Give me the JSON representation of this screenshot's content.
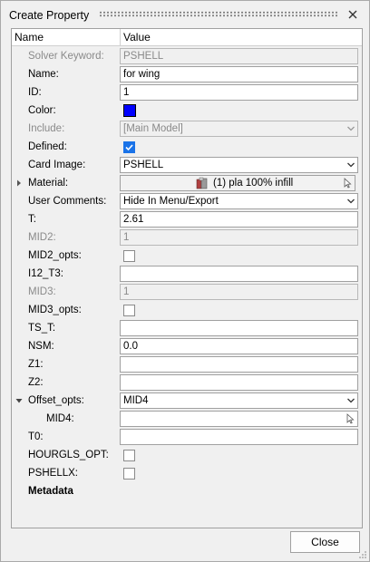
{
  "window": {
    "title": "Create Property"
  },
  "table": {
    "col_name": "Name",
    "col_value": "Value"
  },
  "rows": {
    "solver_keyword": {
      "label": "Solver Keyword:",
      "value": "PSHELL"
    },
    "name": {
      "label": "Name:",
      "value": "for wing"
    },
    "id": {
      "label": "ID:",
      "value": "1"
    },
    "color": {
      "label": "Color:",
      "color": "#0000ff"
    },
    "include": {
      "label": "Include:",
      "value": "[Main Model]"
    },
    "defined": {
      "label": "Defined:",
      "checked": true
    },
    "card_image": {
      "label": "Card Image:",
      "value": "PSHELL"
    },
    "material": {
      "label": "Material:",
      "value": "(1) pla 100% infill"
    },
    "user_comments": {
      "label": "User Comments:",
      "value": "Hide In Menu/Export"
    },
    "t": {
      "label": "T:",
      "value": "2.61"
    },
    "mid2": {
      "label": "MID2:",
      "value": "1"
    },
    "mid2_opts": {
      "label": "MID2_opts:",
      "checked": false
    },
    "i12_t3": {
      "label": "I12_T3:",
      "value": ""
    },
    "mid3": {
      "label": "MID3:",
      "value": "1"
    },
    "mid3_opts": {
      "label": "MID3_opts:",
      "checked": false
    },
    "ts_t": {
      "label": "TS_T:",
      "value": ""
    },
    "nsm": {
      "label": "NSM:",
      "value": "0.0"
    },
    "z1": {
      "label": "Z1:",
      "value": ""
    },
    "z2": {
      "label": "Z2:",
      "value": ""
    },
    "offset_opts": {
      "label": "Offset_opts:",
      "value": "MID4"
    },
    "mid4": {
      "label": "MID4:",
      "value": ""
    },
    "t0": {
      "label": "T0:",
      "value": ""
    },
    "hourgls_opt": {
      "label": "HOURGLS_OPT:",
      "checked": false
    },
    "pshellx": {
      "label": "PSHELLX:",
      "checked": false
    },
    "metadata": {
      "label": "Metadata"
    }
  },
  "footer": {
    "close_label": "Close"
  }
}
